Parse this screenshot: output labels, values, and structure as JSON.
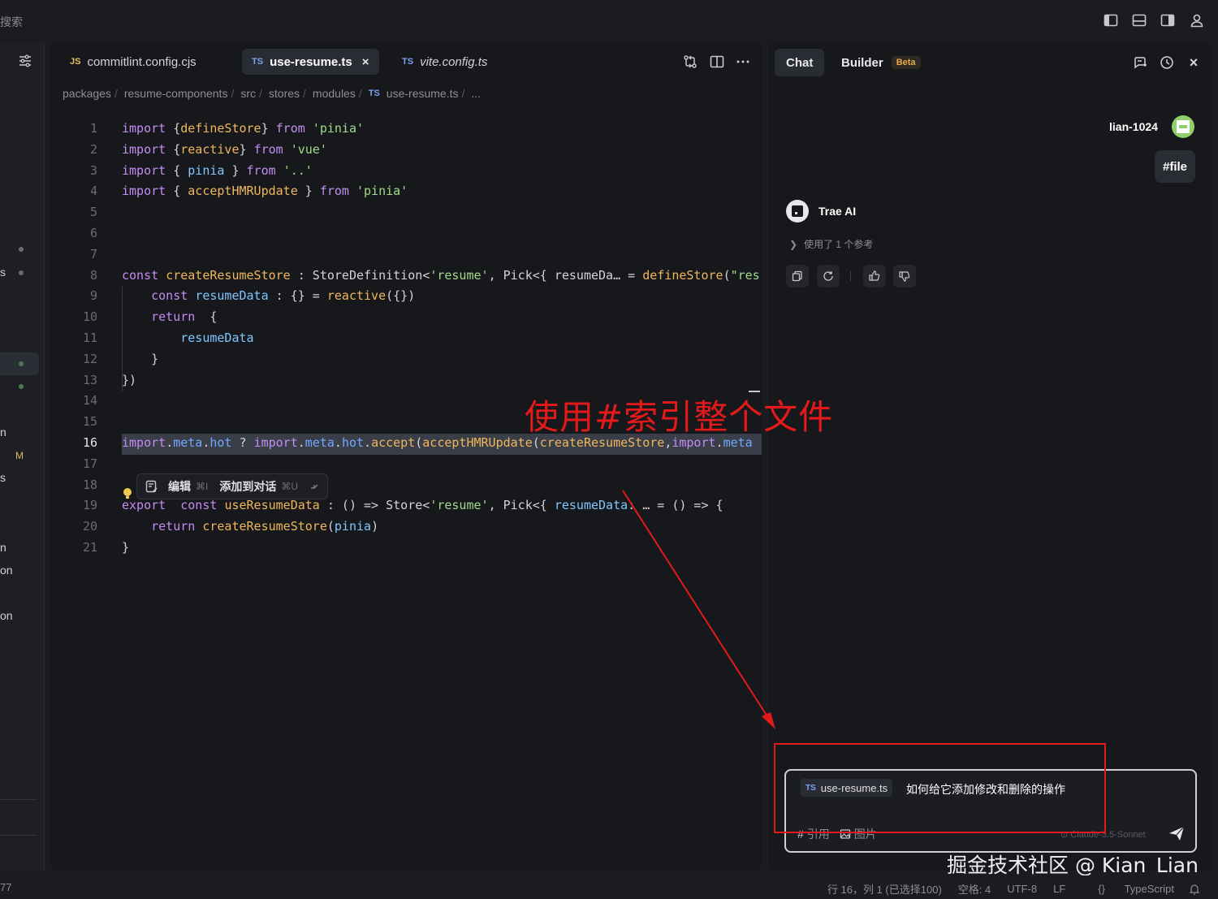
{
  "topbar": {
    "search_label": "搜索",
    "icons": [
      "sidebar-left-icon",
      "panel-bottom-icon",
      "sidebar-right-icon",
      "account-icon"
    ]
  },
  "left_strip": {
    "fragments": [
      "s",
      "n",
      "M",
      "s",
      "n",
      "on",
      "on"
    ],
    "status_line": "77"
  },
  "editor": {
    "tabs": [
      {
        "lang": "JS",
        "name": "commitlint.config.cjs",
        "active": false,
        "italic": false
      },
      {
        "lang": "TS",
        "name": "use-resume.ts",
        "active": true,
        "italic": false,
        "close": "×"
      },
      {
        "lang": "TS",
        "name": "vite.config.ts",
        "active": false,
        "italic": true
      }
    ],
    "actions": [
      "source-control-icon",
      "split-editor-icon",
      "more-icon"
    ],
    "breadcrumb": [
      "packages",
      "resume-components",
      "src",
      "stores",
      "modules"
    ],
    "breadcrumb_file_lang": "TS",
    "breadcrumb_file": "use-resume.ts",
    "breadcrumb_more": "...",
    "current_line": 16,
    "inline_toolbar": {
      "edit_label": "编辑",
      "edit_shortcut": "⌘I",
      "add_label": "添加到对话",
      "add_shortcut": "⌘U"
    }
  },
  "code_lines": [
    {
      "n": 1,
      "text": "import {defineStore} from 'pinia'"
    },
    {
      "n": 2,
      "text": "import {reactive} from 'vue'"
    },
    {
      "n": 3,
      "text": "import { pinia } from '..'"
    },
    {
      "n": 4,
      "text": "import { acceptHMRUpdate } from 'pinia'"
    },
    {
      "n": 5,
      "text": ""
    },
    {
      "n": 6,
      "text": ""
    },
    {
      "n": 7,
      "text": ""
    },
    {
      "n": 8,
      "text": "const createResumeStore : StoreDefinition<'resume', Pick<{ resumeDa… = defineStore(\"res"
    },
    {
      "n": 9,
      "text": "    const resumeData : {} = reactive({})"
    },
    {
      "n": 10,
      "text": "    return  {"
    },
    {
      "n": 11,
      "text": "        resumeData"
    },
    {
      "n": 12,
      "text": "    }"
    },
    {
      "n": 13,
      "text": "})"
    },
    {
      "n": 14,
      "text": ""
    },
    {
      "n": 15,
      "text": ""
    },
    {
      "n": 16,
      "text": "import.meta.hot ? import.meta.hot.accept(acceptHMRUpdate(createResumeStore,import.meta"
    },
    {
      "n": 17,
      "text": ""
    },
    {
      "n": 18,
      "text": ""
    },
    {
      "n": 19,
      "text": "export  const useResumeData : () => Store<'resume', Pick<{ resumeData: … = () => {"
    },
    {
      "n": 20,
      "text": "    return createResumeStore(pinia)"
    },
    {
      "n": 21,
      "text": "}"
    }
  ],
  "annotation": {
    "text": "使用#索引整个文件",
    "color": "#e41a1a"
  },
  "chat": {
    "tabs": [
      {
        "label": "Chat",
        "active": true
      },
      {
        "label": "Builder",
        "badge": "Beta",
        "active": false
      }
    ],
    "actions": [
      "new-chat-icon",
      "history-icon",
      "close-icon"
    ],
    "close_glyph": "×",
    "user": {
      "name": "lian-1024",
      "message": "#file"
    },
    "assistant": {
      "name": "Trae AI",
      "reference_text": "使用了 1 个参考",
      "actions": [
        "copy-icon",
        "regenerate-icon",
        "thumbs-up-icon",
        "thumbs-down-icon"
      ]
    },
    "input": {
      "file_lang": "TS",
      "file_name": "use-resume.ts",
      "text": "如何给它添加修改和删除的操作",
      "ref_label": "引用",
      "ref_glyph": "#",
      "image_label": "图片",
      "model": "Claude-3.5-Sonnet"
    }
  },
  "watermark": "掘金技术社区 @ Kian_Lian",
  "statusbar": {
    "position": "行 16，列 1 (已选择100)",
    "indent": "空格: 4",
    "encoding": "UTF-8",
    "eol": "LF",
    "language": "TypeScript",
    "language_glyph": "{}"
  },
  "colors": {
    "background": "#1b1c20",
    "editor_bg": "#17181c",
    "keyword": "#c38cf2",
    "keyword_blue": "#72a8ff",
    "function": "#f0b75a",
    "string": "#9fdc8a",
    "annotation_red": "#e41a1a",
    "beta_badge": "#e7a94e"
  }
}
